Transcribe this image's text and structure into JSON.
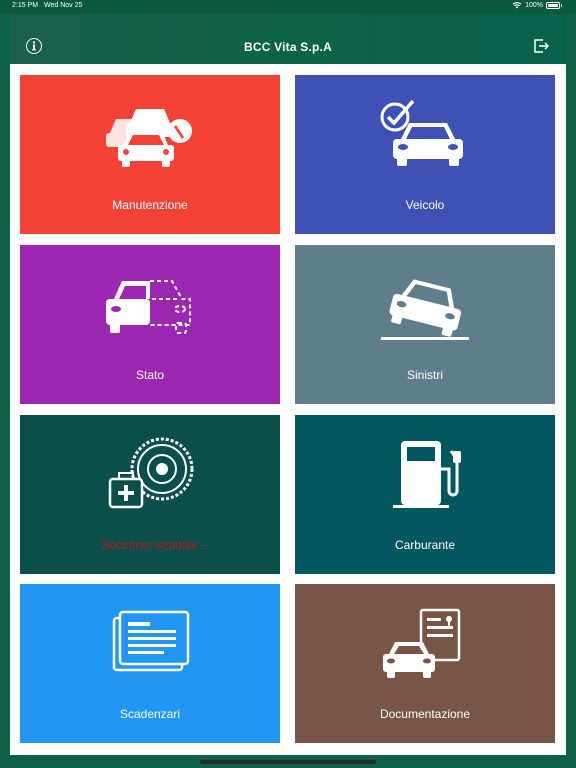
{
  "status": {
    "time": "2:15 PM",
    "date": "Wed Nov 25",
    "battery": "100%"
  },
  "nav": {
    "title": "BCC Vita S.p.A"
  },
  "tiles": [
    {
      "label": "Manutenzione",
      "color": "#f44336"
    },
    {
      "label": "Veicolo",
      "color": "#3f51b5"
    },
    {
      "label": "Stato",
      "color": "#9c27b0"
    },
    {
      "label": "Sinistri",
      "color": "#607d8b"
    },
    {
      "label": "Soccorso stradale",
      "color": "#0b4f4a"
    },
    {
      "label": "Carburante",
      "color": "#00575f"
    },
    {
      "label": "Scadenzari",
      "color": "#2196f3"
    },
    {
      "label": "Documentazione",
      "color": "#795548"
    }
  ]
}
